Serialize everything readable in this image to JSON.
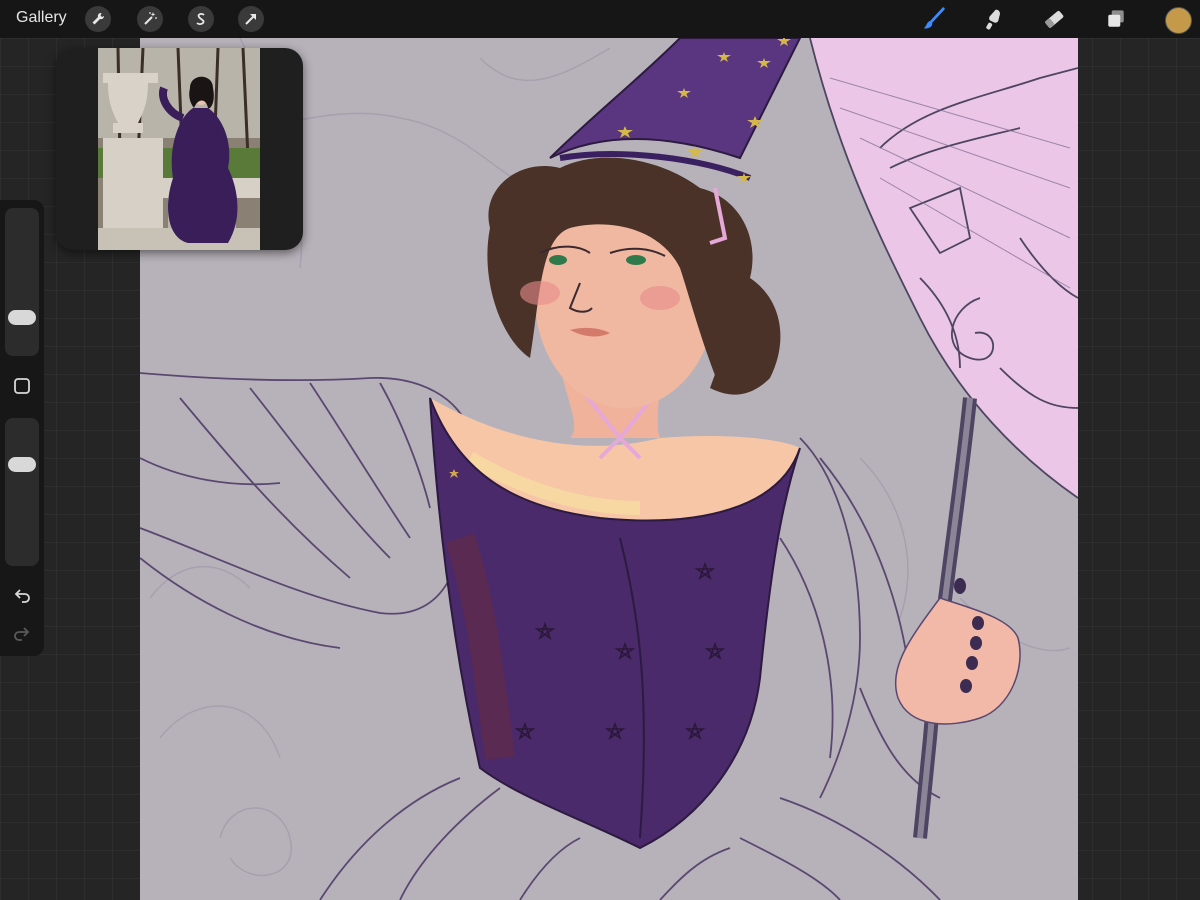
{
  "app": {
    "gallery_label": "Gallery"
  },
  "toolbar": {
    "left_tools": [
      "wrench-icon",
      "magic-wand-icon",
      "selection-s-icon",
      "transform-arrow-icon"
    ],
    "right_tools": [
      "brush-icon",
      "smudge-icon",
      "eraser-icon",
      "layers-icon"
    ],
    "active_tool": "brush-icon",
    "active_color": "#c49a4a",
    "accent_color": "#3d8bff"
  },
  "sidebar": {
    "brush_size_fraction": 0.22,
    "opacity_fraction": 0.72,
    "icons": [
      "modify-square-icon",
      "undo-icon",
      "redo-icon"
    ]
  },
  "reference": {
    "subject": "reference-photo"
  }
}
